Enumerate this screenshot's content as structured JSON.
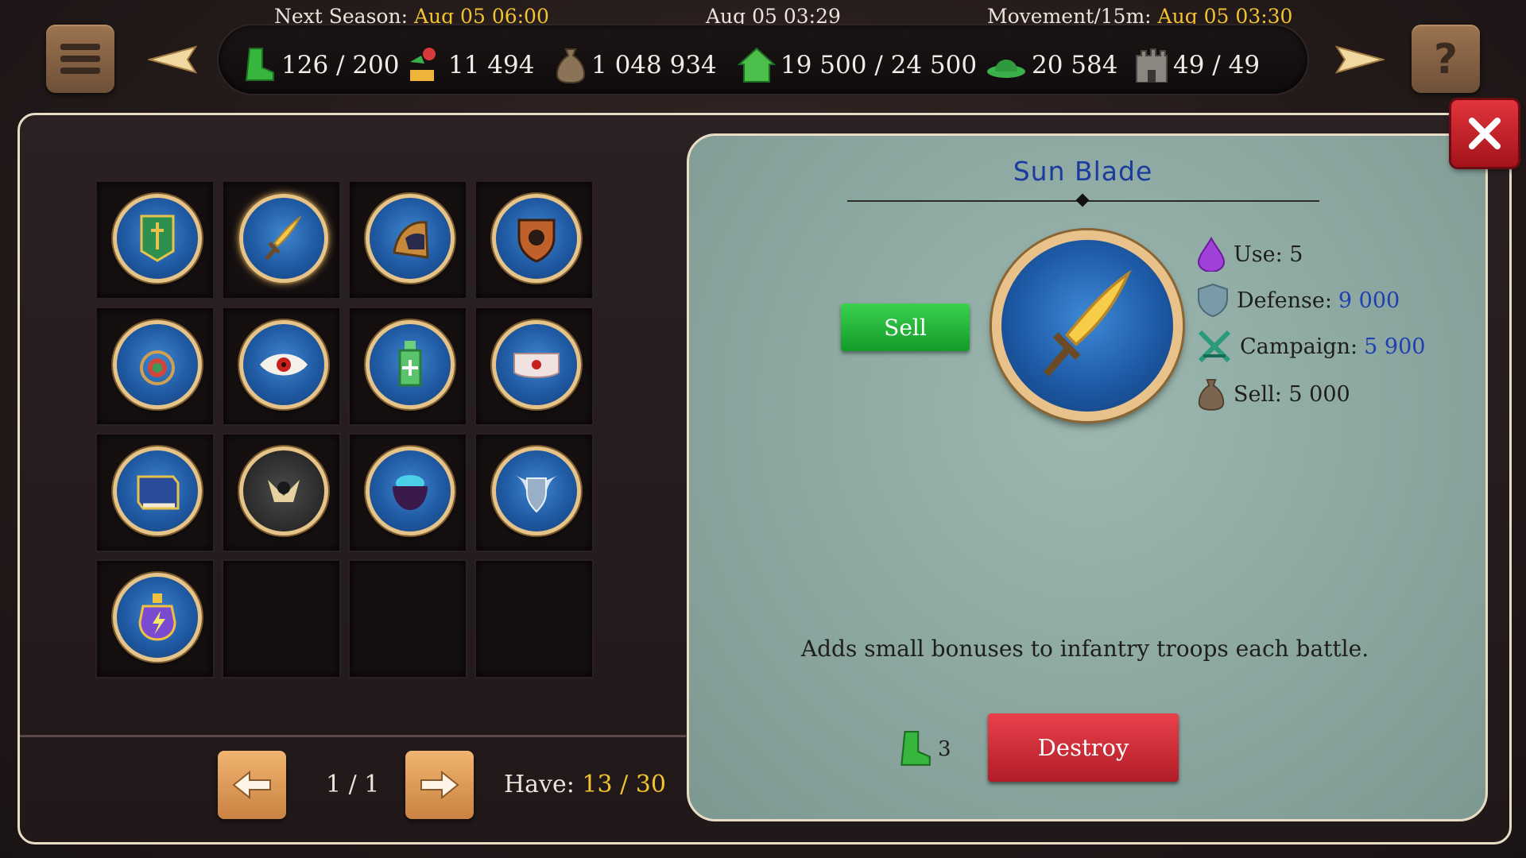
{
  "header": {
    "next_season_label": "Next Season:",
    "next_season_value": "Aug 05 06:00",
    "current_time": "Aug 05 03:29",
    "movement_label": "Movement/15m:",
    "movement_value": "Aug 05 03:30"
  },
  "resources": [
    {
      "icon": "boot-icon",
      "value": "126 / 200"
    },
    {
      "icon": "troops-icon",
      "value": "11 494"
    },
    {
      "icon": "money-bag-icon",
      "value": "1 048 934"
    },
    {
      "icon": "house-icon",
      "value": "19 500 / 24 500"
    },
    {
      "icon": "hat-icon",
      "value": "20 584"
    },
    {
      "icon": "castle-icon",
      "value": "49 / 49"
    }
  ],
  "inventory": {
    "items": [
      {
        "icon": "banner-icon"
      },
      {
        "icon": "sun-blade-icon"
      },
      {
        "icon": "hood-icon"
      },
      {
        "icon": "shield-crest-icon"
      },
      {
        "icon": "amulet-icon"
      },
      {
        "icon": "eye-icon"
      },
      {
        "icon": "potion-bottle-icon"
      },
      {
        "icon": "bandage-icon"
      },
      {
        "icon": "book-icon"
      },
      {
        "icon": "skull-emblem-icon"
      },
      {
        "icon": "cauldron-icon"
      },
      {
        "icon": "winged-shield-icon"
      },
      {
        "icon": "lightning-potion-icon"
      },
      {
        "icon": null
      },
      {
        "icon": null
      },
      {
        "icon": null
      }
    ],
    "page": "1 / 1",
    "have_label": "Have:",
    "have_value": "13 / 30"
  },
  "detail": {
    "title": "Sun Blade",
    "sell_label": "Sell",
    "stats": {
      "use": "Use: 5",
      "defense_label": "Defense:",
      "defense_value": "9 000",
      "campaign_label": "Campaign:",
      "campaign_value": "5 900",
      "sell": "Sell: 5 000"
    },
    "description": "Adds small bonuses to infantry troops each battle.",
    "destroy_cost": "3",
    "destroy_label": "Destroy"
  },
  "colors": {
    "accent_gold": "#f2c230",
    "title_blue": "#1b3c9e",
    "sell_green": "#22b53a",
    "destroy_red": "#d22e38",
    "panel_teal": "#8aa7a0"
  }
}
